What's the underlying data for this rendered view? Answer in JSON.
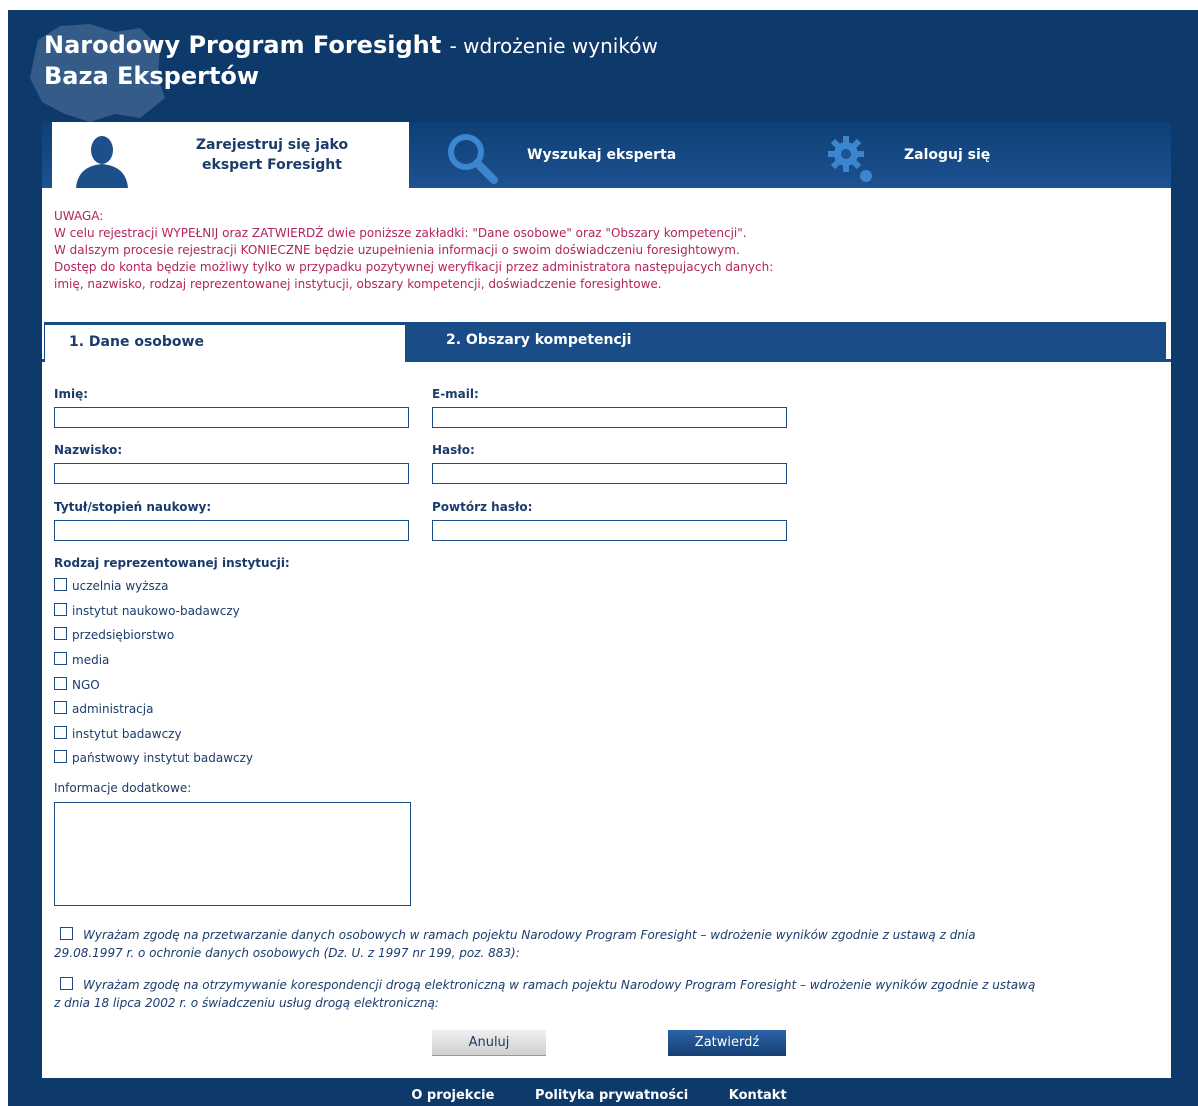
{
  "header": {
    "title": "Narodowy Program Foresight",
    "subtitle": "- wdrożenie wyników",
    "title_line2": "Baza Ekspertów"
  },
  "top_tabs": [
    {
      "label_line1": "Zarejestruj się jako",
      "label_line2": "ekspert Foresight",
      "icon": "user-icon",
      "active": true
    },
    {
      "label": "Wyszukaj eksperta",
      "icon": "search-icon",
      "active": false
    },
    {
      "label": "Zaloguj się",
      "icon": "gear-icon",
      "active": false
    }
  ],
  "notice": {
    "lines": [
      "UWAGA:",
      "W celu rejestracji WYPEŁNIJ oraz ZATWIERDŹ dwie poniższe zakładki: \"Dane osobowe\" oraz \"Obszary kompetencji\".",
      "W dalszym procesie rejestracji KONIECZNE będzie uzupełnienia informacji o swoim doświadczeniu foresightowym.",
      "Dostęp do konta będzie możliwy tylko w przypadku pozytywnej weryfikacji przez administratora następujacych danych:",
      "imię, nazwisko, rodzaj reprezentowanej instytucji, obszary kompetencji, doświadczenie foresightowe."
    ]
  },
  "sub_tabs": [
    "1. Dane osobowe",
    "2. Obszary kompetencji"
  ],
  "form": {
    "first_name_label": "Imię:",
    "last_name_label": "Nazwisko:",
    "title_label": "Tytuł/stopień naukowy:",
    "email_label": "E-mail:",
    "password_label": "Hasło:",
    "repeat_password_label": "Powtórz hasło:",
    "institution_label": "Rodzaj reprezentowanej instytucji:",
    "institution_options": [
      "uczelnia wyższa",
      "instytut naukowo-badawczy",
      "przedsiębiorstwo",
      "media",
      "NGO",
      "administracja",
      "instytut badawczy",
      "państwowy instytut badawczy"
    ],
    "additional_info_label": "Informacje dodatkowe:",
    "consent1_line1": "Wyrażam zgodę na przetwarzanie danych osobowych w ramach pojektu Narodowy Program Foresight – wdrożenie wyników zgodnie z ustawą z dnia",
    "consent1_line2": "29.08.1997 r. o ochronie danych osobowych (Dz. U. z 1997 nr 199, poz. 883):",
    "consent2_line1": "Wyrażam zgodę na otrzymywanie korespondencji drogą elektroniczną w ramach pojektu Narodowy Program Foresight – wdrożenie wyników zgodnie z ustawą",
    "consent2_line2": "z dnia 18 lipca 2002 r. o świadczeniu usług drogą elektroniczną:",
    "cancel_label": "Anuluj",
    "submit_label": "Zatwierdź"
  },
  "footer": [
    "O projekcie",
    "Polityka prywatności",
    "Kontakt"
  ],
  "colors": {
    "navy": "#0e3a6b",
    "notice": "#b2245e",
    "text": "#1b3c6b"
  }
}
